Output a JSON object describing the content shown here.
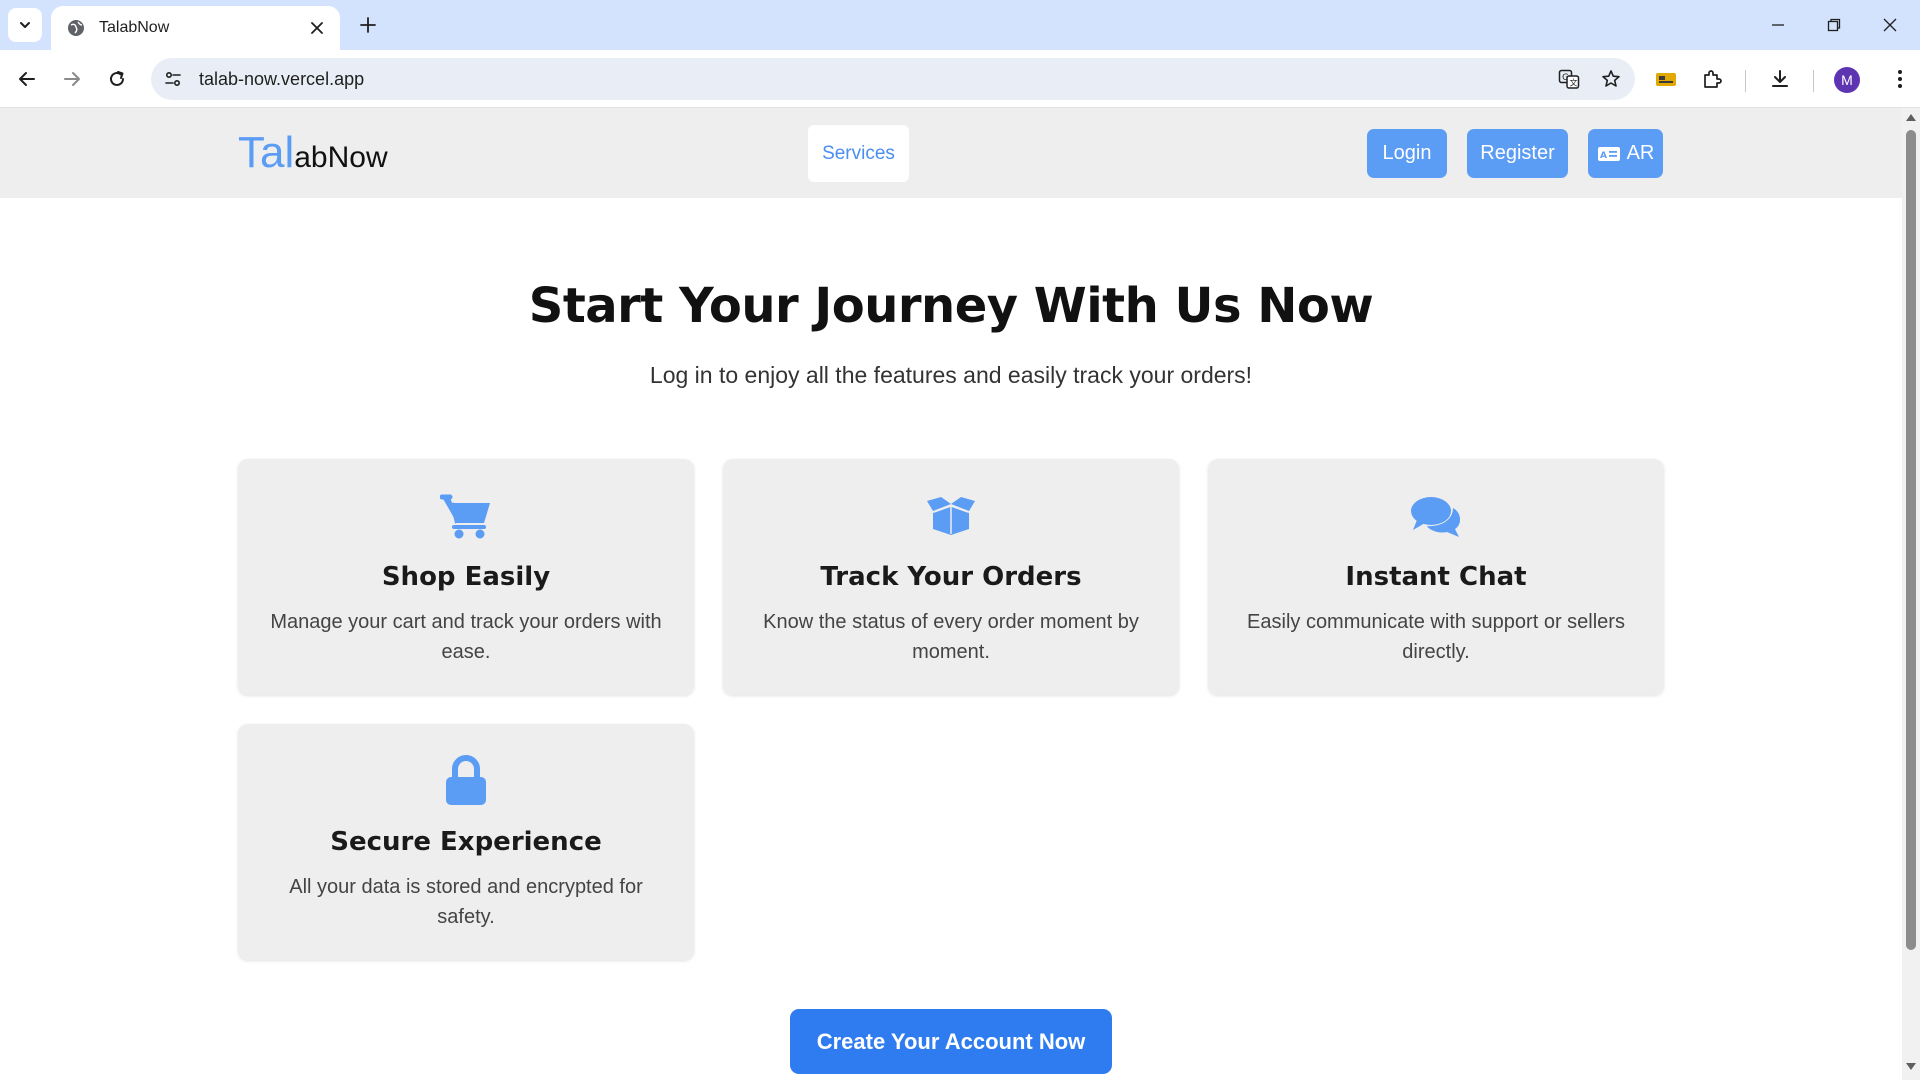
{
  "browser": {
    "tab_title": "TalabNow",
    "url": "talab-now.vercel.app",
    "profile_initial": "M",
    "accent": "#d3e3fd",
    "profile_color": "#5e35b1"
  },
  "site": {
    "logo_part1": "Tal",
    "logo_part2": "abNow",
    "nav_services": "Services",
    "login_label": "Login",
    "register_label": "Register",
    "lang_label": "AR",
    "brand_color": "#5b9cf5",
    "cta_color": "#2f7cf1"
  },
  "hero": {
    "title": "Start Your Journey With Us Now",
    "subtitle": "Log in to enjoy all the features and easily track your orders!"
  },
  "features": [
    {
      "icon": "cart-icon",
      "title": "Shop Easily",
      "desc": "Manage your cart and track your orders with ease."
    },
    {
      "icon": "box-icon",
      "title": "Track Your Orders",
      "desc": "Know the status of every order moment by moment."
    },
    {
      "icon": "chat-icon",
      "title": "Instant Chat",
      "desc": "Easily communicate with support or sellers directly."
    },
    {
      "icon": "lock-icon",
      "title": "Secure Experience",
      "desc": "All your data is stored and encrypted for safety."
    }
  ],
  "cta_label": "Create Your Account Now"
}
